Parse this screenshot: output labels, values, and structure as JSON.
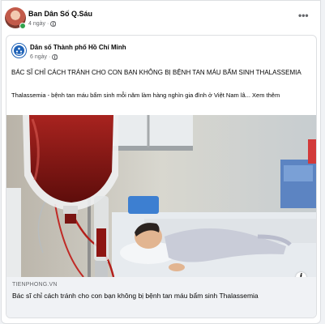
{
  "post": {
    "author": "Ban Dân Số Q.Sáu",
    "time": "4 ngày",
    "more_label": "•••"
  },
  "shared_post": {
    "author": "Dân số Thành phố Hồ Chí Minh",
    "time": "6 ngày",
    "headline": "BÁC SĨ CHỈ CÁCH TRÁNH CHO CON BẠN KHÔNG BỊ BỆNH TAN MÁU BẨM SINH THALASSEMIA",
    "summary": "Thalassemia - bệnh tan máu bẩm sinh mỗi năm làm hàng nghìn gia đình ở Việt Nam lâ...",
    "see_more": "Xem thêm"
  },
  "link_preview": {
    "domain": "TIENPHONG.VN",
    "title": "Bác sĩ chỉ cách tránh cho con bạn không bị bệnh tan máu bẩm sinh Thalassemia",
    "info_label": "i"
  },
  "icons": {
    "privacy": "globe-icon",
    "more": "more-options-icon",
    "info": "info-icon"
  },
  "colors": {
    "online": "#31a24c",
    "secondary_text": "#65676b",
    "link_box_bg": "#f0f2f5"
  }
}
